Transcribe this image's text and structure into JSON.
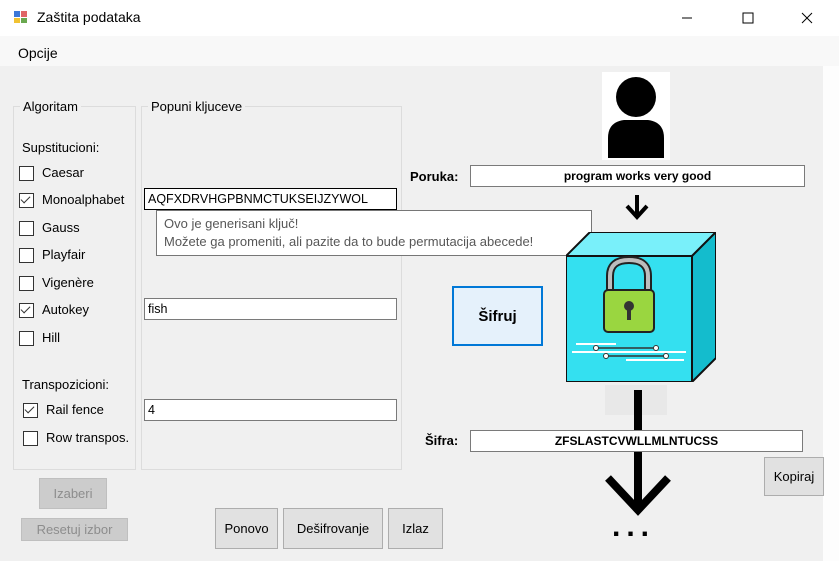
{
  "window": {
    "title": "Zaštita podataka",
    "minimize": "—",
    "maximize": "☐",
    "close": "✕"
  },
  "menu": {
    "options_label": "Opcije"
  },
  "algorithm_group": {
    "title": "Algoritam",
    "substitution_label": "Supstitucioni:",
    "transposition_label": "Transpozicioni:",
    "items": [
      {
        "label": "Caesar",
        "checked": false
      },
      {
        "label": "Monoalphabet",
        "checked": true
      },
      {
        "label": "Gauss",
        "checked": false
      },
      {
        "label": "Playfair",
        "checked": false
      },
      {
        "label": "Vigenère",
        "checked": false
      },
      {
        "label": "Autokey",
        "checked": true
      },
      {
        "label": "Hill",
        "checked": false
      },
      {
        "label": "Rail fence",
        "checked": true
      },
      {
        "label": "Row transpos.",
        "checked": false
      }
    ]
  },
  "keys_group": {
    "title": "Popuni kljuceve",
    "monoalphabet_key": "AQFXDRVHGPBNMCTUKSEIJZYWOL",
    "autokey_key": "fish",
    "rail_fence_key": "4"
  },
  "tooltip": {
    "line1": "Ovo je generisani ključ!",
    "line2": "Možete ga promeniti, ali pazite da to bude permutacija abecede!"
  },
  "buttons": {
    "select": "Izaberi",
    "reset": "Resetuj izbor",
    "again": "Ponovo",
    "decrypt": "Dešifrovanje",
    "exit": "Izlaz",
    "encrypt": "Šifruj",
    "copy": "Kopiraj"
  },
  "message": {
    "label": "Poruka:",
    "value": "program works very good"
  },
  "cipher": {
    "label": "Šifra:",
    "value": "ZFSLASTCVWLLMLNTUCSS"
  },
  "graphics": {
    "person_icon": "person-icon",
    "arrow_icon": "arrow-down-icon",
    "lock_icon": "lock-box-icon",
    "dots": "..."
  },
  "colors": {
    "accent": "#0078d7",
    "lock_cyan": "#34e0f0",
    "lock_green": "#9ad640"
  }
}
